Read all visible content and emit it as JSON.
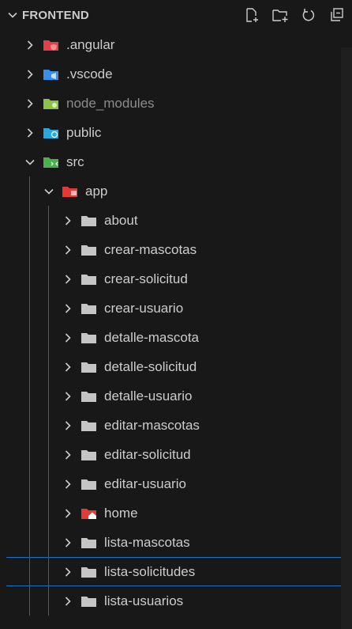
{
  "explorer": {
    "title": "FRONTEND",
    "actions": [
      {
        "name": "new-file",
        "icon": "new-file-icon"
      },
      {
        "name": "new-folder",
        "icon": "new-folder-icon"
      },
      {
        "name": "refresh",
        "icon": "refresh-icon"
      },
      {
        "name": "collapse-all",
        "icon": "collapse-all-icon"
      }
    ]
  },
  "tree": [
    {
      "label": ".angular",
      "depth": 0,
      "expanded": false,
      "icon": "angular-folder-icon",
      "dim": false
    },
    {
      "label": ".vscode",
      "depth": 0,
      "expanded": false,
      "icon": "vscode-folder-icon",
      "dim": false
    },
    {
      "label": "node_modules",
      "depth": 0,
      "expanded": false,
      "icon": "node-folder-icon",
      "dim": true
    },
    {
      "label": "public",
      "depth": 0,
      "expanded": false,
      "icon": "public-folder-icon",
      "dim": false
    },
    {
      "label": "src",
      "depth": 0,
      "expanded": true,
      "icon": "src-folder-icon",
      "dim": false
    },
    {
      "label": "app",
      "depth": 1,
      "expanded": true,
      "icon": "app-folder-icon",
      "dim": false
    },
    {
      "label": "about",
      "depth": 2,
      "expanded": false,
      "icon": "folder-icon",
      "dim": false
    },
    {
      "label": "crear-mascotas",
      "depth": 2,
      "expanded": false,
      "icon": "folder-icon",
      "dim": false
    },
    {
      "label": "crear-solicitud",
      "depth": 2,
      "expanded": false,
      "icon": "folder-icon",
      "dim": false
    },
    {
      "label": "crear-usuario",
      "depth": 2,
      "expanded": false,
      "icon": "folder-icon",
      "dim": false
    },
    {
      "label": "detalle-mascota",
      "depth": 2,
      "expanded": false,
      "icon": "folder-icon",
      "dim": false
    },
    {
      "label": "detalle-solicitud",
      "depth": 2,
      "expanded": false,
      "icon": "folder-icon",
      "dim": false
    },
    {
      "label": "detalle-usuario",
      "depth": 2,
      "expanded": false,
      "icon": "folder-icon",
      "dim": false
    },
    {
      "label": "editar-mascotas",
      "depth": 2,
      "expanded": false,
      "icon": "folder-icon",
      "dim": false
    },
    {
      "label": "editar-solicitud",
      "depth": 2,
      "expanded": false,
      "icon": "folder-icon",
      "dim": false
    },
    {
      "label": "editar-usuario",
      "depth": 2,
      "expanded": false,
      "icon": "folder-icon",
      "dim": false
    },
    {
      "label": "home",
      "depth": 2,
      "expanded": false,
      "icon": "home-folder-icon",
      "dim": false
    },
    {
      "label": "lista-mascotas",
      "depth": 2,
      "expanded": false,
      "icon": "folder-icon",
      "dim": false
    },
    {
      "label": "lista-solicitudes",
      "depth": 2,
      "expanded": false,
      "icon": "folder-icon",
      "dim": false,
      "focused": true
    },
    {
      "label": "lista-usuarios",
      "depth": 2,
      "expanded": false,
      "icon": "folder-icon",
      "dim": false
    }
  ],
  "colors": {
    "background": "#181818",
    "text": "#cccccc",
    "dim_text": "#8c8c8c",
    "focus_border": "#1f6fbf",
    "angular": "#e0404a",
    "vscode": "#3a8ee6",
    "node": "#8bc34a",
    "public": "#29a8e0",
    "src": "#4caf50",
    "app": "#e53935",
    "folder": "#c5c5c5",
    "home": "#e53935"
  }
}
